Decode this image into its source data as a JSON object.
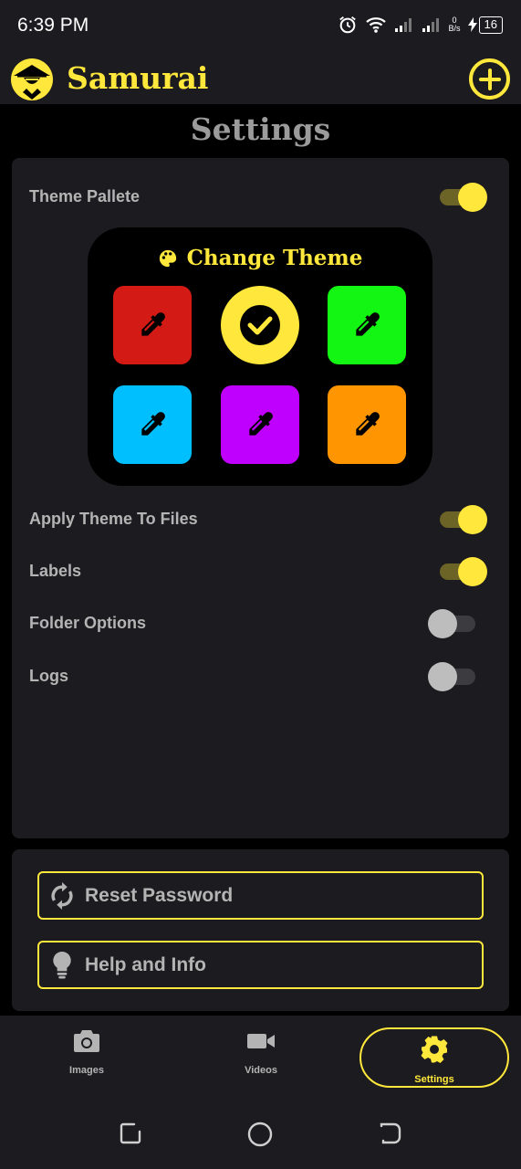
{
  "status_bar": {
    "time": "6:39 PM",
    "net_speed_value": "0",
    "net_speed_unit": "B/s",
    "battery": "16"
  },
  "header": {
    "app_title": "Samurai",
    "add_icon": "add-circle-icon",
    "logo_icon": "samurai-logo-icon"
  },
  "page": {
    "title": "Settings"
  },
  "settings": {
    "theme_pallete": {
      "label": "Theme Pallete",
      "enabled": true
    },
    "theme_panel": {
      "heading": "Change Theme",
      "heading_icon": "palette-icon",
      "swatches": [
        {
          "color": "#d41a14",
          "icon": "eyedropper-icon",
          "selected": false
        },
        {
          "color": "#ffe83b",
          "icon": "check-circle-icon",
          "selected": true
        },
        {
          "color": "#13f512",
          "icon": "eyedropper-icon",
          "selected": false
        },
        {
          "color": "#00bfff",
          "icon": "eyedropper-icon",
          "selected": false
        },
        {
          "color": "#bf00ff",
          "icon": "eyedropper-icon",
          "selected": false
        },
        {
          "color": "#ff9500",
          "icon": "eyedropper-icon",
          "selected": false
        }
      ]
    },
    "toggles": [
      {
        "label": "Apply Theme To Files",
        "enabled": true
      },
      {
        "label": "Labels",
        "enabled": true
      },
      {
        "label": "Folder Options",
        "enabled": false
      },
      {
        "label": "Logs",
        "enabled": false
      }
    ]
  },
  "actions": {
    "reset_password": {
      "label": "Reset Password",
      "icon": "sync-icon"
    },
    "help_info": {
      "label": "Help and Info",
      "icon": "lightbulb-icon"
    }
  },
  "bottom_nav": {
    "items": [
      {
        "label": "Images",
        "icon": "camera-icon",
        "active": false
      },
      {
        "label": "Videos",
        "icon": "video-camera-icon",
        "active": false
      },
      {
        "label": "Settings",
        "icon": "gear-icon",
        "active": true
      }
    ]
  },
  "colors": {
    "accent": "#ffe83b",
    "background": "#1c1b1f",
    "surface": "#000000"
  }
}
